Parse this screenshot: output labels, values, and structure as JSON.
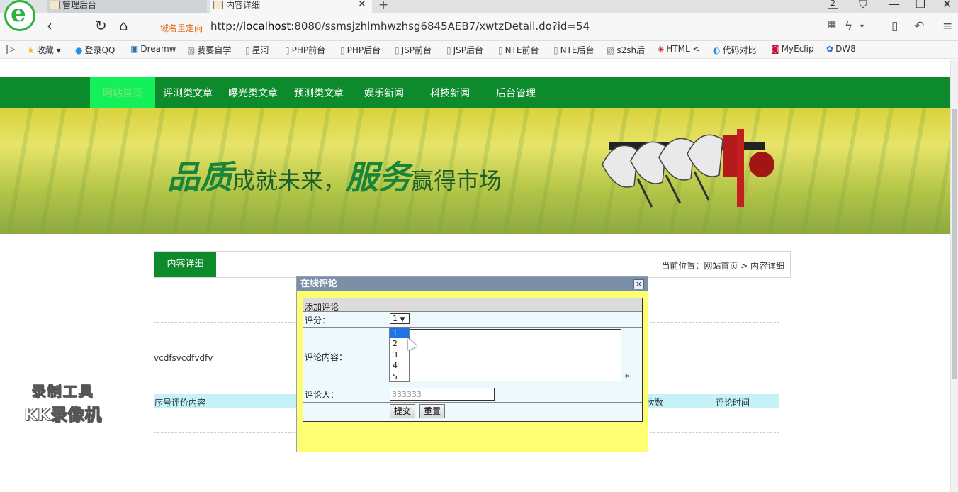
{
  "browser": {
    "tabs": [
      {
        "title": "管理后台",
        "active": false
      },
      {
        "title": "内容详细",
        "active": true
      }
    ],
    "badge_count": "2",
    "redirect_label": "域名重定向",
    "url_prefix": "http://",
    "url_host": "localhost",
    "url_rest": ":8080/ssmsjzhlmhwzhsg6845AEB7/xwtzDetail.do?id=54",
    "bookmarks": [
      "收藏",
      "登录QQ",
      "Dreamw",
      "我要自学",
      "星河",
      "PHP前台",
      "PHP后台",
      "JSP前台",
      "JSP后台",
      "NTE前台",
      "NTE后台",
      "s2sh后",
      "HTML <",
      "代码对比",
      "MyEclip",
      "DW8"
    ]
  },
  "site": {
    "nav": [
      "网站首页",
      "评测类文章",
      "曝光类文章",
      "预测类文章",
      "娱乐新闻",
      "科技新闻",
      "后台管理"
    ],
    "banner_slogan": [
      "品质",
      "成就未来，",
      "服务",
      "赢得市场"
    ],
    "section_title": "内容详细",
    "breadcrumb": "当前位置：网站首页 > 内容详细",
    "content_text": "vcdfsvcdfvdfv",
    "comment_table_headers": [
      "序号",
      "评价内容",
      "次数",
      "评论时间"
    ]
  },
  "watermark": {
    "line1": "录制工具",
    "line2": "KK录像机"
  },
  "dialog": {
    "title": "在线评论",
    "close": "×",
    "form_title": "添加评论",
    "score_label": "评分：",
    "score_value": "1",
    "score_options": [
      "1",
      "2",
      "3",
      "4",
      "5"
    ],
    "content_label": "评论内容：",
    "required_mark": "*",
    "author_label": "评论人：",
    "author_value": "333333",
    "submit_label": "提交",
    "reset_label": "重置"
  },
  "colors": {
    "nav_green": "#0c8a2c",
    "nav_active": "#13f05a",
    "dialog_bg": "#fefe72",
    "table_header": "#c4f2f7"
  }
}
